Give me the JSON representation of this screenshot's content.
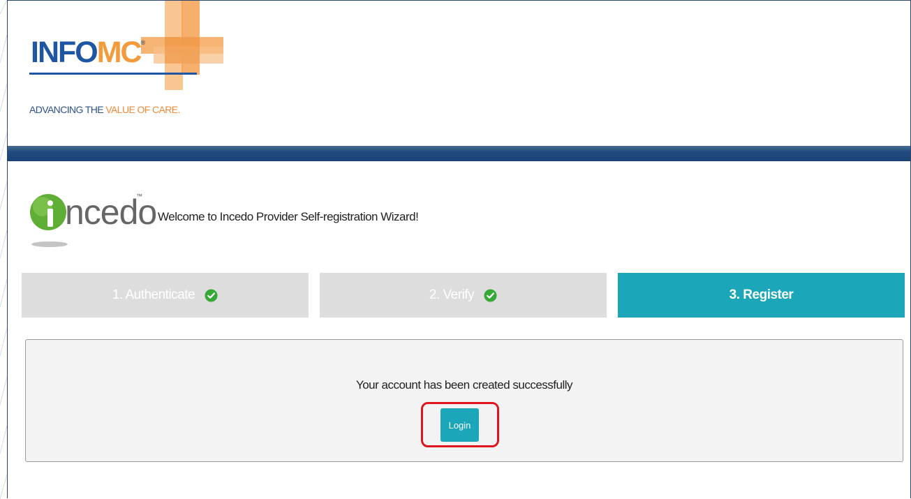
{
  "branding": {
    "infomc_info": "INFO",
    "infomc_mc": "MC",
    "infomc_registered": "®",
    "tagline_prefix": "ADVANCING THE ",
    "tagline_accent": "VALUE OF CARE.",
    "incedo_word": "ncedo",
    "incedo_tm": "™"
  },
  "colors": {
    "brand_blue": "#1f56a3",
    "brand_orange": "#f39a3a",
    "header_band": "#1a4376",
    "accent_teal": "#1ba6ba",
    "step_done_bg": "#dddddd",
    "check_green": "#35a935",
    "highlight_red": "#e0141c",
    "incedo_green": "#5fae35"
  },
  "header": {
    "welcome": "Welcome to Incedo Provider Self-registration Wizard!"
  },
  "wizard": {
    "steps": [
      {
        "label": "1. Authenticate",
        "status": "done",
        "icon": "check-circle-icon"
      },
      {
        "label": "2. Verify",
        "status": "done",
        "icon": "check-circle-icon"
      },
      {
        "label": "3. Register",
        "status": "active"
      }
    ]
  },
  "result": {
    "message": "Your account has been created successfully",
    "login_label": "Login"
  }
}
